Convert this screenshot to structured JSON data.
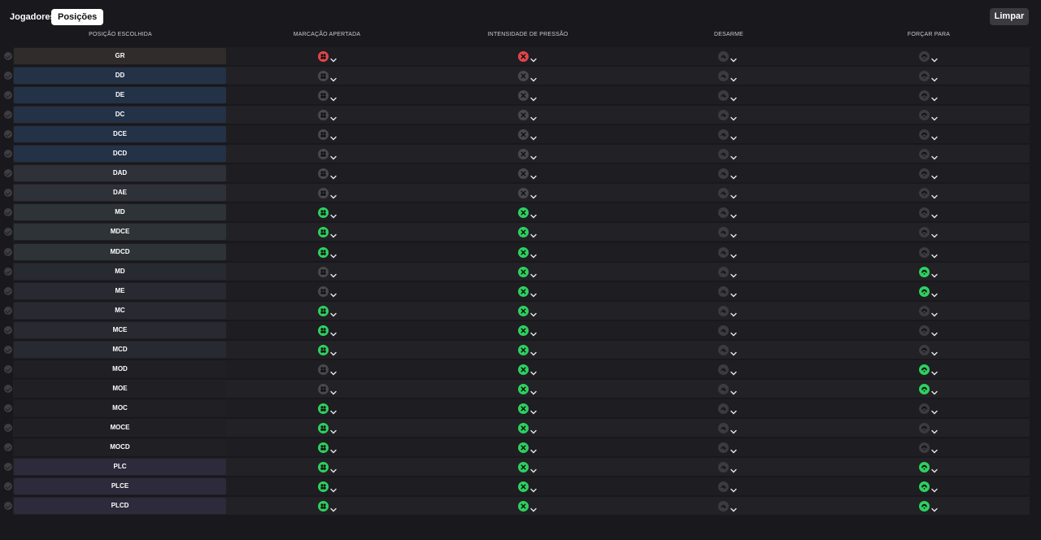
{
  "tabs": [
    {
      "label": "Jogadores",
      "active": false
    },
    {
      "label": "Posições",
      "active": true
    }
  ],
  "clear_button": "Limpar",
  "columns": {
    "position": "POSIÇÃO ESCOLHIDA",
    "marking": "MARCAÇÃO APERTADA",
    "pressing": "INTENSIDADE DE PRESSÃO",
    "tackling": "DESARME",
    "force": "FORÇAR PARA"
  },
  "colors": {
    "red": "#e0474a",
    "green": "#2dd15f",
    "grey": "#48484e"
  },
  "rows": [
    {
      "pos": "GR",
      "group": "gk",
      "marking": "red",
      "pressing": "red",
      "tackling": "dark",
      "force": "dark"
    },
    {
      "pos": "DD",
      "group": "def",
      "marking": "grey",
      "pressing": "grey",
      "tackling": "dark",
      "force": "dark"
    },
    {
      "pos": "DE",
      "group": "def",
      "marking": "grey",
      "pressing": "grey",
      "tackling": "dark",
      "force": "dark"
    },
    {
      "pos": "DC",
      "group": "def",
      "marking": "grey",
      "pressing": "grey",
      "tackling": "dark",
      "force": "dark"
    },
    {
      "pos": "DCE",
      "group": "def",
      "marking": "grey",
      "pressing": "grey",
      "tackling": "dark",
      "force": "dark"
    },
    {
      "pos": "DCD",
      "group": "def",
      "marking": "grey",
      "pressing": "grey",
      "tackling": "dark",
      "force": "dark"
    },
    {
      "pos": "DAD",
      "group": "wb",
      "marking": "grey",
      "pressing": "grey",
      "tackling": "dark",
      "force": "dark"
    },
    {
      "pos": "DAE",
      "group": "wb",
      "marking": "grey",
      "pressing": "grey",
      "tackling": "dark",
      "force": "dark"
    },
    {
      "pos": "MD",
      "group": "dm",
      "marking": "green",
      "pressing": "green",
      "tackling": "dark",
      "force": "dark"
    },
    {
      "pos": "MDCE",
      "group": "dm",
      "marking": "green",
      "pressing": "green",
      "tackling": "dark",
      "force": "dark"
    },
    {
      "pos": "MDCD",
      "group": "dm",
      "marking": "green",
      "pressing": "green",
      "tackling": "dark",
      "force": "dark"
    },
    {
      "pos": "MD",
      "group": "mid",
      "marking": "grey",
      "pressing": "green",
      "tackling": "dark",
      "force": "green"
    },
    {
      "pos": "ME",
      "group": "mid",
      "marking": "grey",
      "pressing": "green",
      "tackling": "dark",
      "force": "green"
    },
    {
      "pos": "MC",
      "group": "mid",
      "marking": "green",
      "pressing": "green",
      "tackling": "dark",
      "force": "dark"
    },
    {
      "pos": "MCE",
      "group": "mid",
      "marking": "green",
      "pressing": "green",
      "tackling": "dark",
      "force": "dark"
    },
    {
      "pos": "MCD",
      "group": "mid",
      "marking": "green",
      "pressing": "green",
      "tackling": "dark",
      "force": "dark"
    },
    {
      "pos": "MOD",
      "group": "am",
      "marking": "grey",
      "pressing": "green",
      "tackling": "dark",
      "force": "green"
    },
    {
      "pos": "MOE",
      "group": "am",
      "marking": "grey",
      "pressing": "green",
      "tackling": "dark",
      "force": "green"
    },
    {
      "pos": "MOC",
      "group": "am",
      "marking": "green",
      "pressing": "green",
      "tackling": "dark",
      "force": "dark"
    },
    {
      "pos": "MOCE",
      "group": "am",
      "marking": "green",
      "pressing": "green",
      "tackling": "dark",
      "force": "dark"
    },
    {
      "pos": "MOCD",
      "group": "am",
      "marking": "green",
      "pressing": "green",
      "tackling": "dark",
      "force": "dark"
    },
    {
      "pos": "PLC",
      "group": "st",
      "marking": "green",
      "pressing": "green",
      "tackling": "dark",
      "force": "green"
    },
    {
      "pos": "PLCE",
      "group": "st",
      "marking": "green",
      "pressing": "green",
      "tackling": "dark",
      "force": "green"
    },
    {
      "pos": "PLCD",
      "group": "st",
      "marking": "green",
      "pressing": "green",
      "tackling": "dark",
      "force": "green"
    }
  ]
}
